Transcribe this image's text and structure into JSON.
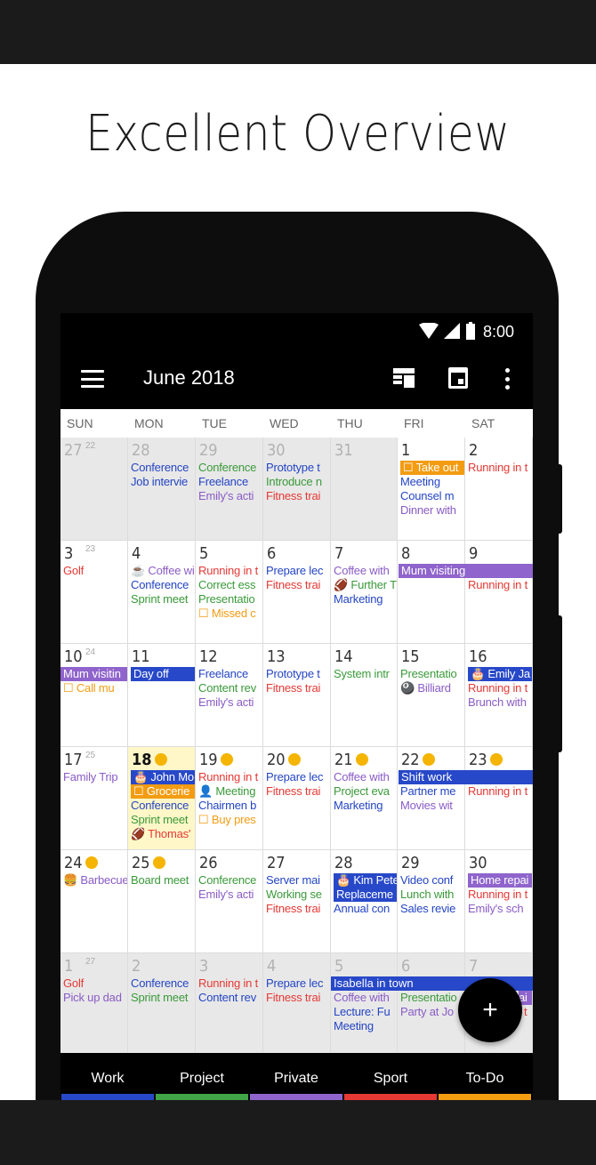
{
  "headline": "Excellent Overview",
  "status": {
    "time": "8:00"
  },
  "appbar": {
    "month": "June 2018"
  },
  "days_of_week": [
    "SUN",
    "MON",
    "TUE",
    "WED",
    "THU",
    "FRI",
    "SAT"
  ],
  "week_numbers": [
    "22",
    "23",
    "24",
    "25",
    "26",
    "27"
  ],
  "dates": [
    [
      "27",
      "28",
      "29",
      "30",
      "31",
      "1",
      "2"
    ],
    [
      "3",
      "4",
      "5",
      "6",
      "7",
      "8",
      "9"
    ],
    [
      "10",
      "11",
      "12",
      "13",
      "14",
      "15",
      "16"
    ],
    [
      "17",
      "18",
      "19",
      "20",
      "21",
      "22",
      "23"
    ],
    [
      "24",
      "25",
      "26",
      "27",
      "28",
      "29",
      "30"
    ],
    [
      "1",
      "2",
      "3",
      "4",
      "5",
      "6",
      "7"
    ]
  ],
  "events": {
    "w0": {
      "mon": [
        "Conference",
        "Job intervie"
      ],
      "tue": [
        "Conference",
        "Freelance",
        "Emily's acti"
      ],
      "wed": [
        "Prototype t",
        "Introduce n",
        "Fitness trai"
      ],
      "fri": [
        "☐ Take out",
        "Meeting",
        "Counsel m",
        "Dinner with"
      ],
      "sat": [
        "Running in t"
      ]
    },
    "w1": {
      "sun": [
        "Golf"
      ],
      "mon": [
        "☕ Coffee wi",
        "Conference",
        "Sprint meet"
      ],
      "tue": [
        "Running in t",
        "Correct ess",
        "Presentatio",
        "☐ Missed c"
      ],
      "wed": [
        "Prepare lec",
        "Fitness trai"
      ],
      "thu": [
        "Coffee with",
        "🏈 Further Tr",
        "Marketing"
      ],
      "span": "Mum visiting",
      "sat": [
        "Running in t"
      ]
    },
    "w2": {
      "span": "Mum visitin",
      "sun": [
        "☐ Call mu"
      ],
      "mon_bar": "Day off",
      "tue": [
        "Freelance",
        "Content rev",
        "Emily's acti"
      ],
      "wed": [
        "Prototype t",
        "Fitness trai"
      ],
      "thu": [
        "System intr"
      ],
      "fri": [
        "Presentatio",
        "🎱 Billiard"
      ],
      "sat_bar": "🎂 Emily Ja",
      "sat": [
        "Running in t",
        "Brunch with"
      ]
    },
    "w3": {
      "sun": [
        "Family Trip"
      ],
      "mon_bar1": "🎂 John Mo",
      "mon_bar2": "☐ Grocerie",
      "mon": [
        "Conference",
        "Sprint meet",
        "🏈 Thomas'"
      ],
      "tue": [
        "Running in t",
        "👤 Meeting",
        "Chairmen b",
        "☐ Buy pres"
      ],
      "wed": [
        "Prepare lec",
        "Fitness trai"
      ],
      "thu": [
        "Coffee with",
        "Project eva",
        "Marketing"
      ],
      "span": "Shift work",
      "fri": [
        "Partner me",
        "Movies wit"
      ],
      "sat": [
        "Running in t"
      ]
    },
    "w4": {
      "sun": [
        "🍔 Barbecue"
      ],
      "mon": [
        "Board meet"
      ],
      "tue": [
        "Conference",
        "Emily's acti"
      ],
      "wed": [
        "Server mai",
        "Working se",
        "Fitness trai"
      ],
      "thu_bar1": "🎂 Kim Pete",
      "thu_bar2": "Replaceme",
      "thu": [
        "Annual con"
      ],
      "fri": [
        "Video conf",
        "Lunch with",
        "Sales revie"
      ],
      "sat_bar": "Home repai",
      "sat": [
        "Running in t",
        "Emily's sch"
      ]
    },
    "w5": {
      "sun": [
        "Golf",
        "Pick up dad"
      ],
      "mon": [
        "Conference",
        "Sprint meet"
      ],
      "tue": [
        "Running in t",
        "Content rev"
      ],
      "wed": [
        "Prepare lec",
        "Fitness trai"
      ],
      "span": "Isabella in town",
      "thu": [
        "Coffee with",
        "Lecture: Fu",
        "Meeting"
      ],
      "fri": [
        "Presentatio",
        "Party at Jo"
      ],
      "sat_bar": "ai",
      "sat": [
        "t"
      ]
    }
  },
  "fab": {
    "label": "+"
  },
  "legend": [
    {
      "label": "Work",
      "color": "#2748c8"
    },
    {
      "label": "Project",
      "color": "#41a447"
    },
    {
      "label": "Private",
      "color": "#8f64cc"
    },
    {
      "label": "Sport",
      "color": "#e53935"
    },
    {
      "label": "To-Do",
      "color": "#f39c12"
    }
  ]
}
